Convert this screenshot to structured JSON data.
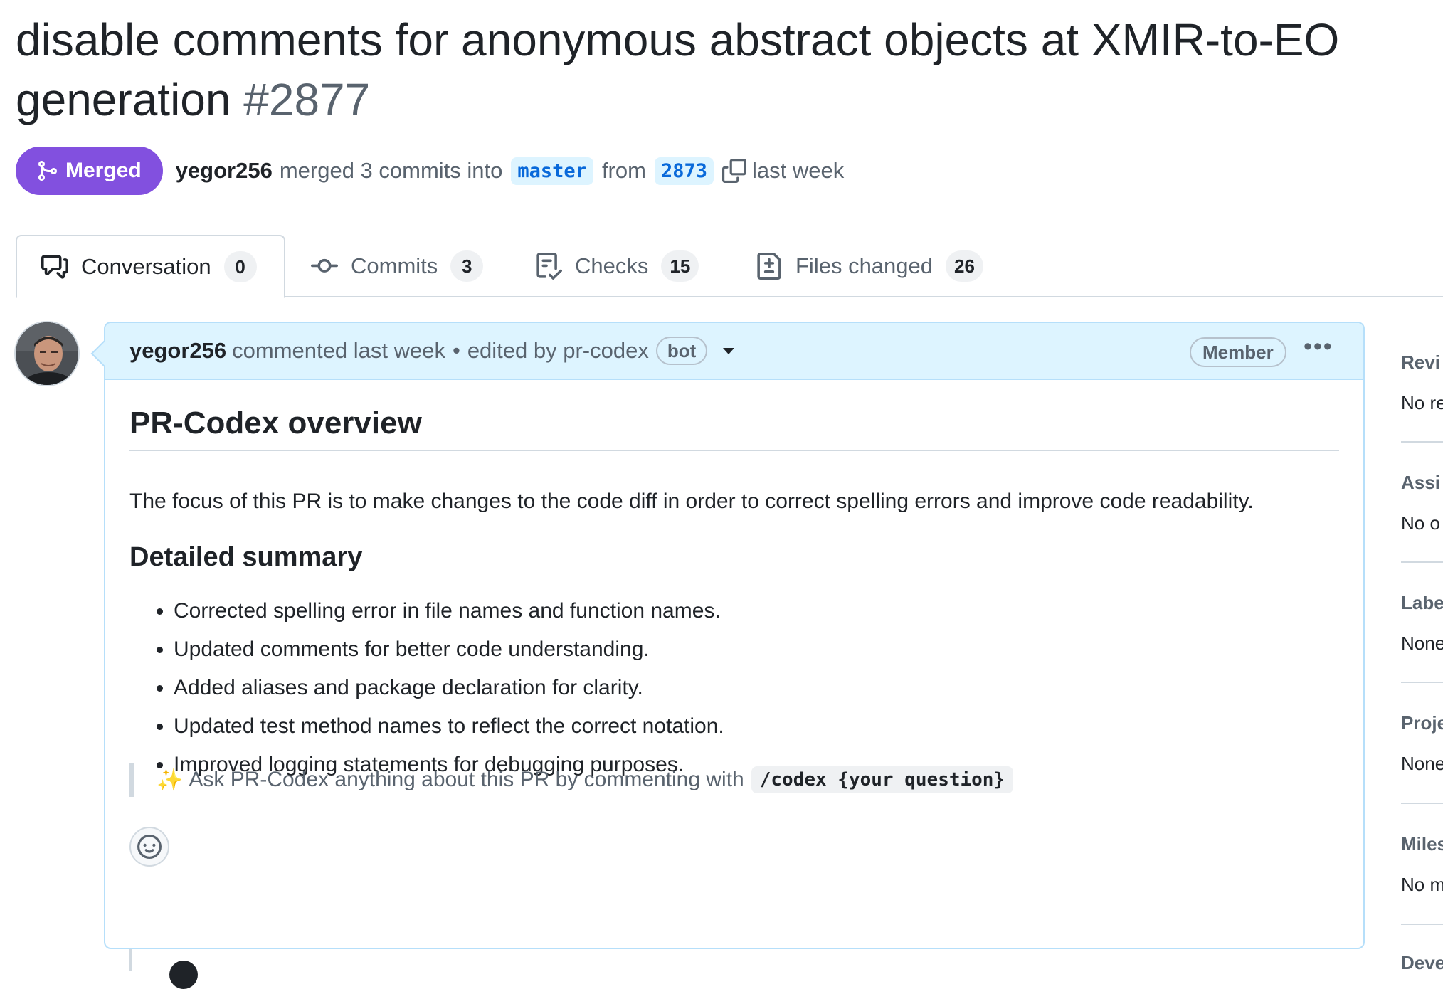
{
  "pr": {
    "title": "disable comments for anonymous abstract objects at XMIR-to-EO generation",
    "number": "#2877",
    "state": "Merged",
    "author": "yegor256",
    "merge_text": "merged 3 commits into",
    "base_branch": "master",
    "from_text": "from",
    "head_branch": "2873",
    "time": "last week"
  },
  "tabs": [
    {
      "label": "Conversation",
      "count": "0"
    },
    {
      "label": "Commits",
      "count": "3"
    },
    {
      "label": "Checks",
      "count": "15"
    },
    {
      "label": "Files changed",
      "count": "26"
    }
  ],
  "comment": {
    "author": "yegor256",
    "action": "commented last week",
    "separator": "•",
    "edited_text": "edited by pr-codex",
    "bot_label": "bot",
    "member_label": "Member",
    "heading": "PR-Codex overview",
    "paragraph": "The focus of this PR is to make changes to the code diff in order to correct spelling errors and improve code readability.",
    "subheading": "Detailed summary",
    "items": [
      "Corrected spelling error in file names and function names.",
      "Updated comments for better code understanding.",
      "Added aliases and package declaration for clarity.",
      "Updated test method names to reflect the correct notation.",
      "Improved logging statements for debugging purposes."
    ],
    "quote_sparkle": "✨",
    "quote_text": "Ask PR-Codex anything about this PR by commenting with",
    "quote_code": "/codex {your question}"
  },
  "sidebar": {
    "sections": [
      {
        "heading": "Revi",
        "value": "No re"
      },
      {
        "heading": "Assi",
        "value": "No o"
      },
      {
        "heading": "Labe",
        "value": "None"
      },
      {
        "heading": "Proje",
        "value": "None"
      },
      {
        "heading": "Miles",
        "value": "No m"
      },
      {
        "heading": "Deve",
        "value": ""
      }
    ]
  },
  "colors": {
    "merged": "#8250df",
    "link": "#0969da",
    "comment_header": "#ddf4ff"
  },
  "icons": [
    "git-merge-icon",
    "copy-icon",
    "comment-discussion-icon",
    "git-commit-icon",
    "checklist-icon",
    "file-diff-icon",
    "kebab-horizontal-icon",
    "smiley-icon",
    "triangle-down-icon"
  ]
}
